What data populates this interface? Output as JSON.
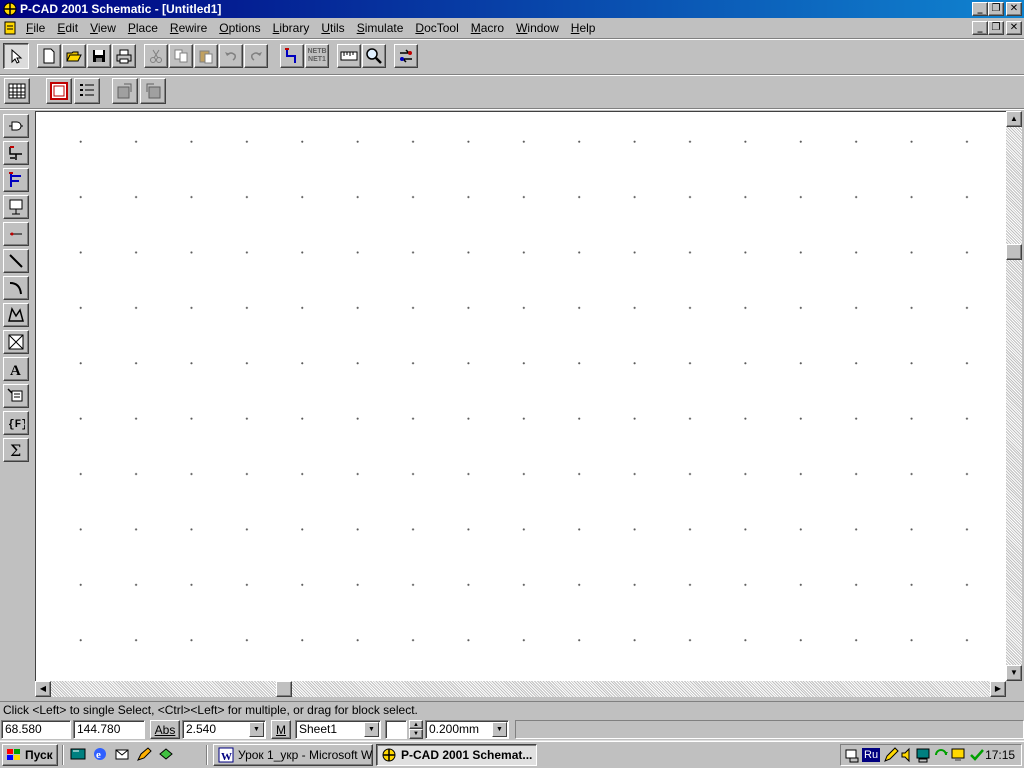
{
  "window": {
    "title": "P-CAD 2001 Schematic - [Untitled1]",
    "icon": "pcad-app-icon",
    "controls": [
      "minimize-icon",
      "restore-icon",
      "close-icon"
    ]
  },
  "menu": [
    {
      "label": "File",
      "accel": "F",
      "rest": "ile"
    },
    {
      "label": "Edit",
      "accel": "E",
      "rest": "dit"
    },
    {
      "label": "View",
      "accel": "V",
      "rest": "iew"
    },
    {
      "label": "Place",
      "accel": "P",
      "rest": "lace"
    },
    {
      "label": "Rewire",
      "accel": "R",
      "rest": "ewire"
    },
    {
      "label": "Options",
      "accel": "O",
      "rest": "ptions"
    },
    {
      "label": "Library",
      "accel": "L",
      "rest": "ibrary"
    },
    {
      "label": "Utils",
      "accel": "U",
      "rest": "tils"
    },
    {
      "label": "Simulate",
      "accel": "S",
      "rest": "imulate"
    },
    {
      "label": "DocTool",
      "accel": "D",
      "rest": "ocTool"
    },
    {
      "label": "Macro",
      "accel": "M",
      "rest": "acro"
    },
    {
      "label": "Window",
      "accel": "W",
      "rest": "indow"
    },
    {
      "label": "Help",
      "accel": "H",
      "rest": "elp"
    }
  ],
  "toolbar_main": {
    "select": "select-arrow-icon",
    "new": "new-document-icon",
    "open": "open-folder-icon",
    "save": "save-disk-icon",
    "print": "print-icon",
    "cut": "cut-icon",
    "copy": "copy-icon",
    "paste": "paste-icon",
    "undo": "undo-icon",
    "redo": "redo-icon",
    "wire": "wire-tool-icon",
    "netlist_top": "NETB",
    "netlist_bottom": "NET1",
    "measure": "measure-ruler-icon",
    "zoom": "zoom-magnifier-icon",
    "simulate": "simulate-icon"
  },
  "toolbar_second": [
    "grid-table-icon",
    "sheet-frame-icon",
    "list-icon",
    "library-a-icon",
    "library-b-icon"
  ],
  "left_tools": [
    "place-part-icon",
    "place-wire-icon",
    "place-bus-icon",
    "place-port-icon",
    "place-pin-icon",
    "place-line-icon",
    "place-arc-icon",
    "place-polygon-icon",
    "place-ieee-symbol-icon",
    "place-text-icon",
    "place-attribute-icon",
    "place-field-icon",
    "place-sum-icon"
  ],
  "status": {
    "message": "Click <Left> to single Select, <Ctrl><Left> for multiple, or drag for block select.",
    "x": "68.580",
    "y": "144.780",
    "abs": "Abs",
    "grid": "2.540",
    "m": "M",
    "sheet": "Sheet1",
    "line_width": "0.200mm"
  },
  "taskbar": {
    "start": "Пуск",
    "quick_launch": [
      "show-desktop-icon",
      "ie-icon",
      "outlook-express-icon",
      "ftp-icon",
      "channels-icon"
    ],
    "tasks": [
      {
        "label": "Урок 1_укр - Microsoft W...",
        "active": false
      },
      {
        "label": "P-CAD 2001 Schemat...",
        "active": true
      }
    ],
    "language": "Ru",
    "clock": "17:15"
  }
}
